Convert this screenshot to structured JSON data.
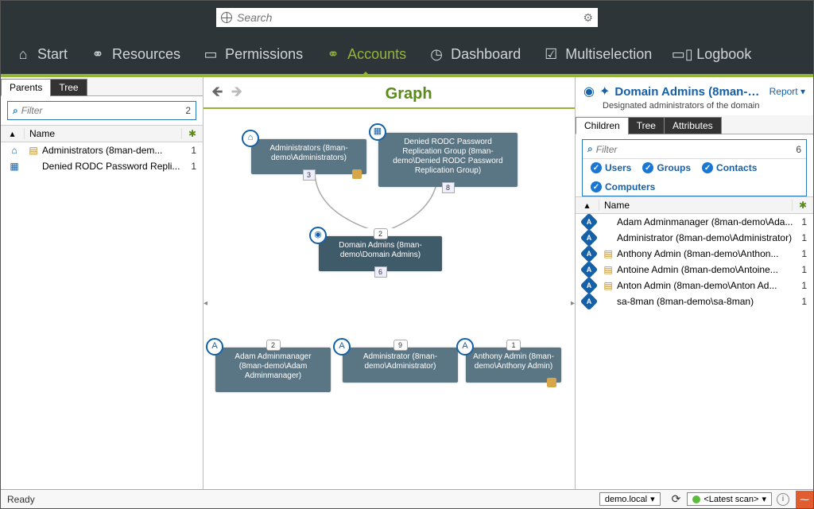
{
  "search": {
    "placeholder": "Search"
  },
  "nav": {
    "items": [
      {
        "label": "Start"
      },
      {
        "label": "Resources"
      },
      {
        "label": "Permissions"
      },
      {
        "label": "Accounts"
      },
      {
        "label": "Dashboard"
      },
      {
        "label": "Multiselection"
      },
      {
        "label": "Logbook"
      }
    ]
  },
  "left": {
    "tabs": {
      "parents": "Parents",
      "tree": "Tree"
    },
    "filter": {
      "placeholder": "Filter",
      "count": "2"
    },
    "colname": "Name",
    "rows": [
      {
        "name": "Administrators (8man-dem...",
        "count": "1",
        "folder": true,
        "icon": "home"
      },
      {
        "name": "Denied RODC Password Repli...",
        "count": "1",
        "folder": false,
        "icon": "list"
      }
    ]
  },
  "center": {
    "title": "Graph",
    "nodes": {
      "n1": {
        "label": "Administrators (8man-demo\\Administrators)",
        "tag": "3"
      },
      "n2": {
        "label": "Denied RODC Password Replication Group (8man-demo\\Denied RODC Password Replication Group)",
        "tag": "8"
      },
      "n3": {
        "label": "Domain Admins (8man-demo\\Domain Admins)",
        "topnum": "2",
        "tag": "6"
      },
      "n4": {
        "label": "Adam Adminmanager (8man-demo\\Adam Adminmanager)",
        "topnum": "2"
      },
      "n5": {
        "label": "Administrator (8man-demo\\Administrator)",
        "topnum": "9"
      },
      "n6": {
        "label": "Anthony Admin (8man-demo\\Anthony Admin)",
        "topnum": "1"
      }
    }
  },
  "right": {
    "title": "Domain Admins (8man-d...",
    "report": "Report",
    "desc": "Designated administrators of the domain",
    "tabs": {
      "children": "Children",
      "tree": "Tree",
      "attributes": "Attributes"
    },
    "filter": {
      "placeholder": "Filter",
      "count": "6"
    },
    "chips": {
      "users": "Users",
      "groups": "Groups",
      "contacts": "Contacts",
      "computers": "Computers"
    },
    "colname": "Name",
    "rows": [
      {
        "name": "Adam Adminmanager (8man-demo\\Ada...",
        "count": "1",
        "folder": false
      },
      {
        "name": "Administrator (8man-demo\\Administrator)",
        "count": "1",
        "folder": false
      },
      {
        "name": "Anthony Admin (8man-demo\\Anthon...",
        "count": "1",
        "folder": true
      },
      {
        "name": "Antoine Admin (8man-demo\\Antoine...",
        "count": "1",
        "folder": true
      },
      {
        "name": "Anton Admin (8man-demo\\Anton Ad...",
        "count": "1",
        "folder": true
      },
      {
        "name": "sa-8man (8man-demo\\sa-8man)",
        "count": "1",
        "folder": false
      }
    ]
  },
  "status": {
    "ready": "Ready",
    "domain": "demo.local",
    "scan": "<Latest scan>"
  }
}
